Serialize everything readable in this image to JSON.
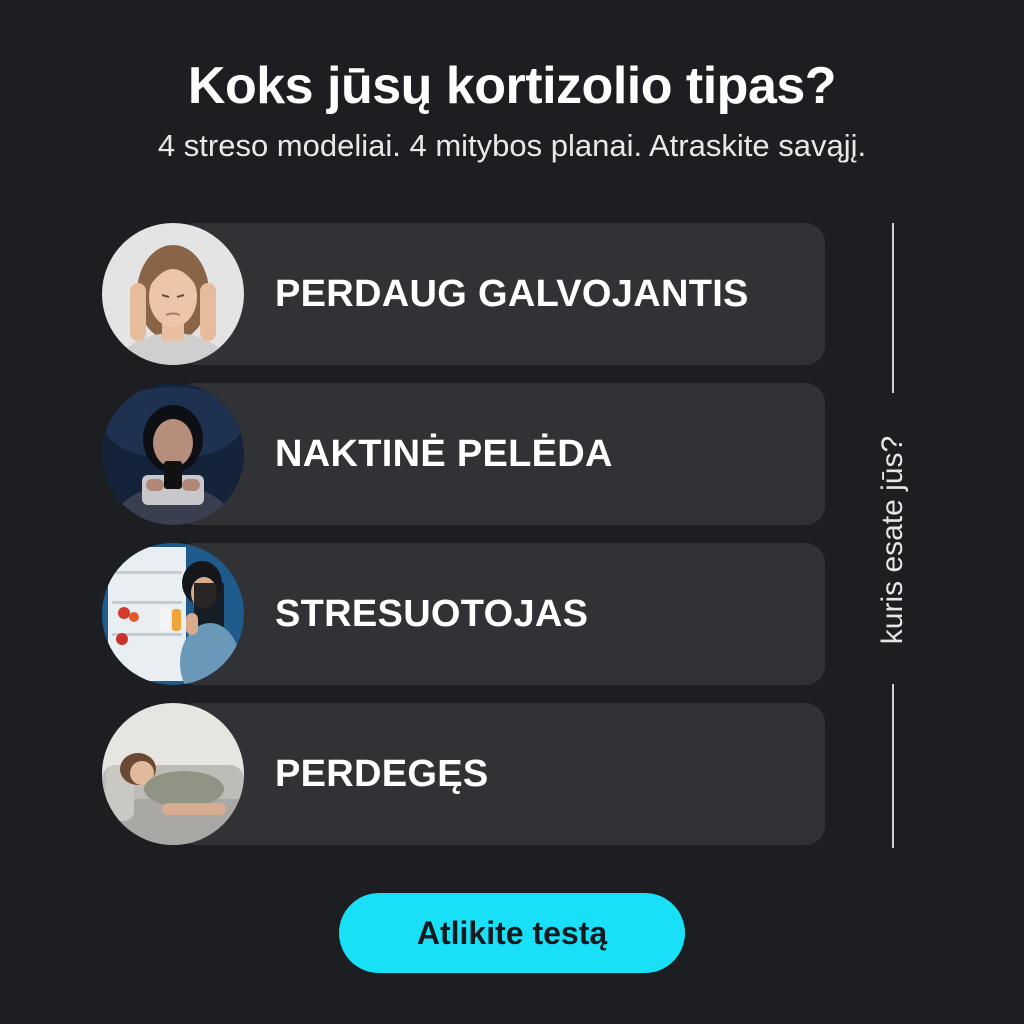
{
  "header": {
    "title": "Koks jūsų kortizolio tipas?",
    "subtitle": "4 streso modeliai. 4 mitybos planai. Atraskite savąjį."
  },
  "types": [
    {
      "label": "PERDAUG GALVOJANTIS",
      "image": "woman-holding-head-photo"
    },
    {
      "label": "NAKTINĖ PELĖDA",
      "image": "woman-using-phone-in-bed-photo"
    },
    {
      "label": "STRESUOTOJAS",
      "image": "woman-at-open-fridge-photo"
    },
    {
      "label": "PERDEGĘS",
      "image": "woman-lying-on-sofa-photo"
    }
  ],
  "side_label": "kuris esate jūs?",
  "cta": {
    "label": "Atlikite testą"
  },
  "colors": {
    "background": "#1c1e21",
    "card": "#303236",
    "accent": "#18e0f7",
    "text": "#ffffff"
  }
}
